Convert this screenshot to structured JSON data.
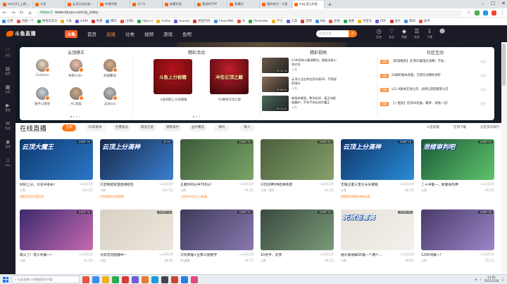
{
  "browser": {
    "tabs": [
      {
        "label": "hao123_上网从这里开始"
      },
      {
        "label": "斗鱼"
      },
      {
        "label": "云顶之弈全新版本"
      },
      {
        "label": "哔哩哔哩"
      },
      {
        "label": "(1) 今"
      },
      {
        "label": "收藏页面"
      },
      {
        "label": "爱游戏TOP"
      },
      {
        "label": "直播间"
      },
      {
        "label": "我的关注 - 斗鱼"
      },
      {
        "label": "lol云顶之弈直播_lol云顶之弈",
        "active": true
      }
    ],
    "url_scheme": "https://",
    "url_host": "www.douyu.com/g_yldzy",
    "bookmarks": [
      "应用",
      "百度一下",
      "网易云音乐",
      "小说",
      "4399",
      "免费",
      "腾讯",
      "(全网)",
      "https://",
      "milian",
      "human",
      "爬虫代码",
      "CleanPNG",
      "AI",
      "Illustrator",
      "学习",
      "工具",
      "官网",
      "B站",
      "其他",
      "视频",
      "阿里云",
      "PDF",
      "设计",
      "新闻",
      "读书"
    ]
  },
  "site_header": {
    "logo": "斗鱼直播",
    "brand_badge": "斗鱼",
    "nav": [
      "首页",
      "直播",
      "分类",
      "视频",
      "游戏",
      "鱼吧"
    ],
    "active_nav_index": 1,
    "search_placeholder": "云顶之弈",
    "header_icons": [
      {
        "name": "history-icon",
        "label": "历史",
        "glyph": "◷"
      },
      {
        "name": "follow-icon",
        "label": "关注",
        "glyph": "♡"
      },
      {
        "name": "level-icon",
        "label": "等级",
        "glyph": "◆"
      },
      {
        "name": "task-icon",
        "label": "任务",
        "glyph": "☰"
      },
      {
        "name": "download-icon",
        "label": "下载",
        "glyph": "⇩"
      },
      {
        "name": "user-avatar-icon",
        "label": "",
        "glyph": "☻"
      }
    ]
  },
  "sidebar": {
    "items": [
      {
        "name": "sidebar-item-follow",
        "label": "关注",
        "glyph": "♡"
      },
      {
        "name": "sidebar-item-recommend",
        "label": "推荐",
        "glyph": "▤"
      },
      {
        "name": "sidebar-item-category",
        "label": "分类",
        "glyph": "▦"
      },
      {
        "name": "sidebar-item-video",
        "label": "视频",
        "glyph": "▶"
      },
      {
        "name": "sidebar-item-yuba",
        "label": "鱼吧",
        "glyph": "✉"
      },
      {
        "name": "sidebar-item-game",
        "label": "游戏",
        "glyph": "◉"
      },
      {
        "name": "sidebar-item-app",
        "label": "App",
        "glyph": "▯"
      }
    ]
  },
  "hero": {
    "columns": {
      "anchors_title": "云顶棋王",
      "events_title": "精彩活动",
      "videos_title": "精彩视频",
      "community_title": "社区互动"
    },
    "anchors": [
      {
        "name": "Coldove",
        "color": "#e8d8c8"
      },
      {
        "name": "林雨小深~",
        "color": "#f1c2b2"
      },
      {
        "name": "初凰馨语",
        "color": "#d9b08c"
      },
      {
        "name": "旗手以南星",
        "color": "#c7d6e8"
      },
      {
        "name": "AC遥猫",
        "color": "#cfa98a"
      },
      {
        "name": "吴亦zzz",
        "color": "#b9c2cc"
      }
    ],
    "events": [
      {
        "title": "斗鱼制胜上分攻略集",
        "caption": "斗鱼上分秘籍",
        "color1": "#b3121a",
        "color2": "#5a0b0e"
      },
      {
        "title": "S5赛季云顶之巅",
        "caption": "冲击云顶之巅",
        "color1": "#c21f2b",
        "color2": "#3a070a"
      }
    ],
    "videos": [
      {
        "title": "6.06双神斗重组羁绊，超级无敌小贤对决",
        "author": "斗鱼",
        "duration": "00:12:30",
        "color": "#6a5a48"
      },
      {
        "title": "云顶小丑白到金恶作剧20，不细说把细节",
        "author": "斗鱼",
        "duration": "00:08:02",
        "color": "#8a6b54"
      },
      {
        "title": "新版本最强，教你玩转，真正的超级霸炉，不知不觉玩成大魔王",
        "author": "斗鱼",
        "duration": "00:15:41",
        "color": "#4a6a5a"
      }
    ],
    "community": [
      {
        "tag": "话题",
        "title": "【阵容推荐】云顶S5最强全攻略！学会...",
        "date": "近日"
      },
      {
        "tag": "话题",
        "title": "S5解析版本改版，全新玩法教你进阶",
        "date": "近日"
      },
      {
        "tag": "话题",
        "title": "v11.9版本云顶之弈：光明与黑暗重新公告",
        "date": "近日"
      },
      {
        "tag": "话题",
        "title": "【一图流】云顶S5装备、羁绊、转换一览！",
        "date": "近日"
      }
    ]
  },
  "live": {
    "heading": "在线直播",
    "filters": [
      "全部",
      "S5新版本",
      "巨爆福武",
      "最强王者",
      "钢铁棋手",
      "画手覆盖",
      "横升",
      "颗人"
    ],
    "active_filter_index": 0,
    "right_links": [
      "斗鱼客服",
      "在线下载",
      "分区资讯排行"
    ],
    "cards": [
      {
        "title": "好好上分，大号冲本命！",
        "cat": "lol云顶之弈",
        "author": "斗鱼",
        "hot": "122.2万",
        "quality": "1080P 30",
        "caption": "云顶大魔王",
        "tip": "猛兽巨匠的可爱对决",
        "bg1": "#0e3b6e",
        "bg2": "#2b76c7"
      },
      {
        "title": "只定制冠军连连德哈巨",
        "cat": "lol云顶之弈",
        "author": "斗鱼",
        "hot": "111.5万",
        "quality": "2K 60",
        "caption": "云顶上分滴神",
        "tip": "打到棋盘中比赛赛季",
        "bg1": "#17284a",
        "bg2": "#3a7fd0"
      },
      {
        "title": "王者600分冲700分!",
        "cat": "lol云顶之弈",
        "author": "斗鱼",
        "hot": "76.3万",
        "quality": "1080P 30",
        "caption": "",
        "tip": "斗鱼合作云顶上分联盟",
        "bg1": "#3c5a3a",
        "bg2": "#7aa568"
      },
      {
        "title": "只玩双神VN召唤阵营",
        "cat": "lol云顶之弈",
        "author": "斗鱼一直在",
        "hot": "61.6万",
        "quality": "1080P 60",
        "caption": "",
        "tip": "",
        "bg1": "#4a5e3c",
        "bg2": "#86a06a"
      },
      {
        "title": "无限王者三宝大头天使版",
        "cat": "lol云顶之弈",
        "author": "斗鱼",
        "hot": "48.5万",
        "quality": "1080P 30",
        "caption": "云顶上分滴神",
        "tip": "刚刚转回原赛季的老玩家",
        "bg1": "#0f3566",
        "bg2": "#2a8bd8"
      },
      {
        "title": "二十冲第一，新版本的神",
        "cat": "lol云顶之弈",
        "author": "斗鱼",
        "hot": "45.0万",
        "quality": "1080P 30",
        "caption": "泄楼审判吧",
        "tip": "",
        "bg1": "#1d5a3a",
        "bg2": "#5ec46a"
      },
      {
        "title": "吸火了！前十冲第一！",
        "cat": "lol云顶之弈",
        "author": "斗鱼",
        "hot": "41.0万",
        "quality": "1080P 30",
        "caption": "",
        "tip": "1.80",
        "bg1": "#3c2a6e",
        "bg2": "#c66ab0"
      },
      {
        "title": "文欣花花陪播中~",
        "cat": "lol云顶之弈",
        "author": "斗鱼",
        "hot": "38.4万",
        "quality": "1080P 30",
        "caption": "",
        "tip": "玩云顶之弈一起快乐吧",
        "bg1": "#d8d0c4",
        "bg2": "#ece6dc"
      },
      {
        "title": "只玩英雄+五费三星教学",
        "cat": "lol云顶之弈",
        "author": "AC遥猫",
        "hot": "33.7万",
        "quality": "1080P 30",
        "caption": "",
        "tip": "",
        "bg1": "#3e3a5a",
        "bg2": "#8a78b0"
      },
      {
        "title": "10点半，云顶",
        "cat": "lol云顶之弈",
        "author": "斗鱼",
        "hot": "30.2万",
        "quality": "1080P 30",
        "caption": "",
        "tip": "",
        "bg1": "#3a4a40",
        "bg2": "#7a9a78"
      },
      {
        "title": "她大家讲解S5第一个两个…",
        "cat": "lol云顶之弈",
        "author": "斗鱼",
        "hot": "28.8万",
        "quality": "1080P 60",
        "caption": "无敌运营骑",
        "tip": "",
        "bg1": "#e6e2da",
        "bg2": "#f4f1ec"
      },
      {
        "title": "1200冲第一!",
        "cat": "lol云顶之弈",
        "author": "斗鱼",
        "hot": "25.1万",
        "quality": "1080P 30",
        "caption": "",
        "tip": "",
        "bg1": "#4a3a6a",
        "bg2": "#9a86c8"
      }
    ]
  },
  "taskbar": {
    "search_placeholder": "在这里输入你要搜索的内容",
    "time": "13:05",
    "date": "2021/5/18",
    "apps": [
      "#e8553d",
      "#3a8ee6",
      "#f2b01e",
      "#2fa84f",
      "#d33b3b",
      "#6f5bd6",
      "#e77c2a",
      "#1b9bd7",
      "#444",
      "#c43",
      "#2a7de1",
      "#e04a7a"
    ]
  }
}
